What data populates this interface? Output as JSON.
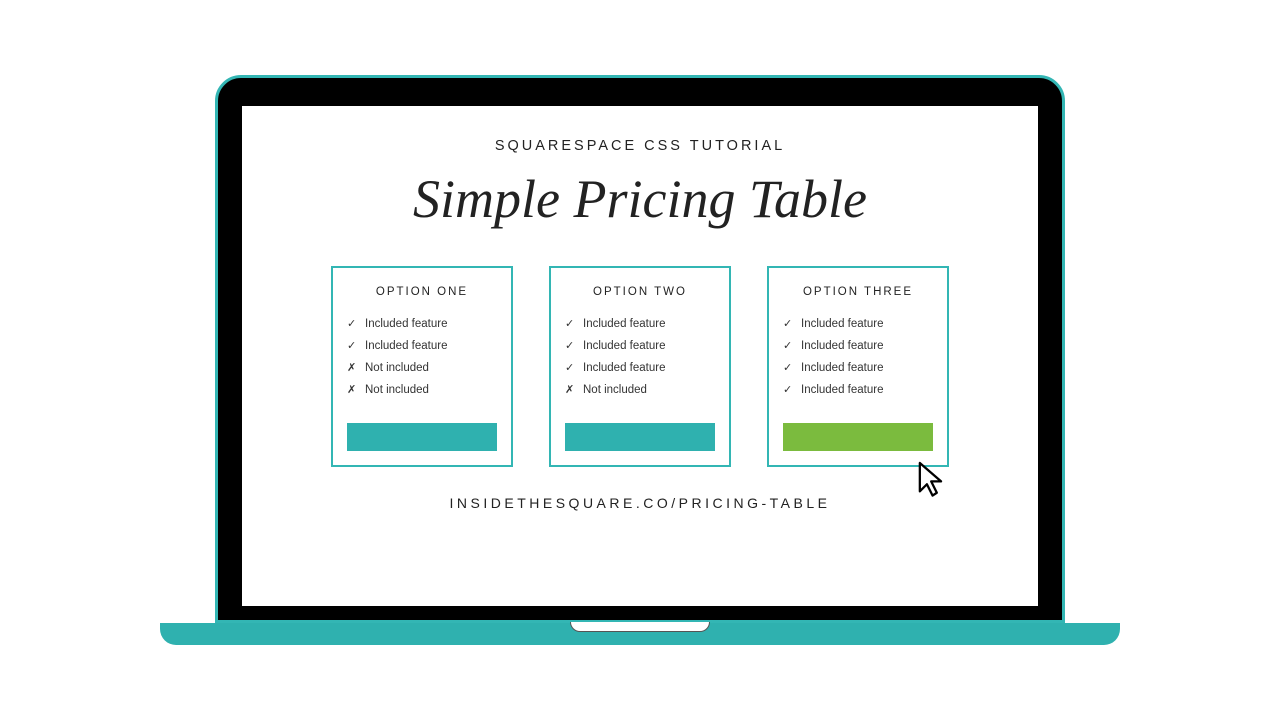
{
  "eyebrow": "SQUARESPACE CSS TUTORIAL",
  "title": "Simple Pricing Table",
  "footer_link": "INSIDETHESQUARE.CO/PRICING-TABLE",
  "colors": {
    "teal": "#2fb1af",
    "teal_border": "#33b6b4",
    "green": "#7bbb3e",
    "black": "#000000"
  },
  "marks": {
    "included": "✓",
    "not_included": "✗"
  },
  "cards": [
    {
      "title": "OPTION ONE",
      "features": [
        {
          "mark": "included",
          "text": "Included feature"
        },
        {
          "mark": "included",
          "text": "Included feature"
        },
        {
          "mark": "not_included",
          "text": "Not included"
        },
        {
          "mark": "not_included",
          "text": "Not included"
        }
      ],
      "button_variant": "default"
    },
    {
      "title": "OPTION TWO",
      "features": [
        {
          "mark": "included",
          "text": "Included feature"
        },
        {
          "mark": "included",
          "text": "Included feature"
        },
        {
          "mark": "included",
          "text": "Included feature"
        },
        {
          "mark": "not_included",
          "text": "Not included"
        }
      ],
      "button_variant": "default"
    },
    {
      "title": "OPTION THREE",
      "features": [
        {
          "mark": "included",
          "text": "Included feature"
        },
        {
          "mark": "included",
          "text": "Included feature"
        },
        {
          "mark": "included",
          "text": "Included feature"
        },
        {
          "mark": "included",
          "text": "Included feature"
        }
      ],
      "button_variant": "alt"
    }
  ]
}
